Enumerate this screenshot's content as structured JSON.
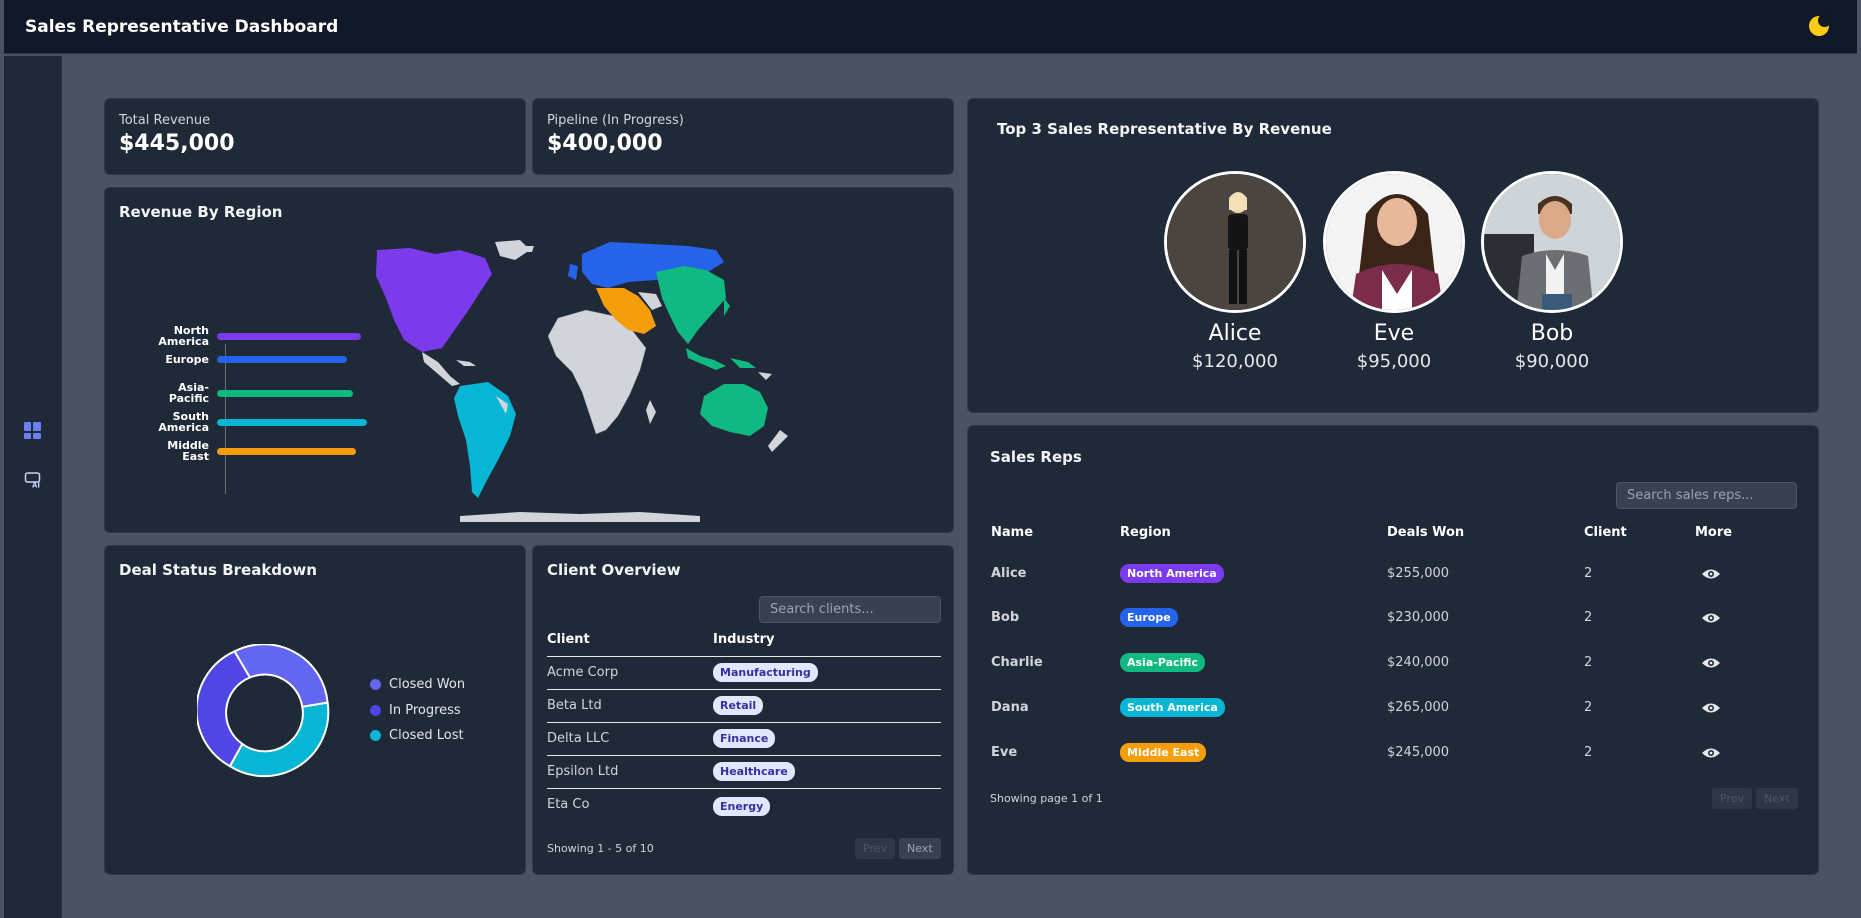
{
  "header": {
    "title": "Sales Representative Dashboard",
    "theme_icon": "moon-icon"
  },
  "sidebar": {
    "items": [
      {
        "icon": "dashboard-icon"
      },
      {
        "icon": "ai-icon"
      }
    ]
  },
  "kpis": {
    "total_revenue": {
      "label": "Total Revenue",
      "value": "$445,000"
    },
    "pipeline": {
      "label": "Pipeline (In Progress)",
      "value": "$400,000"
    }
  },
  "revenue_by_region": {
    "title": "Revenue By Region",
    "regions": [
      {
        "label_line1": "North",
        "label_line2": "America",
        "color": "#7c3aed"
      },
      {
        "label_line1": "Europe",
        "label_line2": "",
        "color": "#2563eb"
      },
      {
        "label_line1": "Asia-Pacific",
        "label_line2": "",
        "color": "#10b981"
      },
      {
        "label_line1": "South",
        "label_line2": "America",
        "color": "#06b6d4"
      },
      {
        "label_line1": "Middle East",
        "label_line2": "",
        "color": "#f59e0b"
      }
    ]
  },
  "chart_data": {
    "type": "bar",
    "categories": [
      "North America",
      "Europe",
      "Asia-Pacific",
      "South America",
      "Middle East"
    ],
    "values": [
      255000,
      230000,
      240000,
      265000,
      245000
    ],
    "title": "Revenue By Region"
  },
  "deal_status": {
    "title": "Deal Status Breakdown",
    "legend": [
      {
        "label": "Closed Won",
        "color": "#6366f1"
      },
      {
        "label": "In Progress",
        "color": "#4f46e5"
      },
      {
        "label": "Closed Lost",
        "color": "#06b6d4"
      }
    ]
  },
  "client_overview": {
    "title": "Client Overview",
    "search_placeholder": "Search clients...",
    "headers": {
      "client": "Client",
      "industry": "Industry"
    },
    "rows": [
      {
        "client": "Acme Corp",
        "industry": "Manufacturing"
      },
      {
        "client": "Beta Ltd",
        "industry": "Retail"
      },
      {
        "client": "Delta LLC",
        "industry": "Finance"
      },
      {
        "client": "Epsilon Ltd",
        "industry": "Healthcare"
      },
      {
        "client": "Eta Co",
        "industry": "Energy"
      }
    ],
    "footer": "Showing 1 - 5 of 10",
    "prev": "Prev",
    "next": "Next"
  },
  "top_reps": {
    "title": "Top 3 Sales Representative By Revenue",
    "reps": [
      {
        "name": "Alice",
        "revenue": "$120,000"
      },
      {
        "name": "Eve",
        "revenue": "$95,000"
      },
      {
        "name": "Bob",
        "revenue": "$90,000"
      }
    ]
  },
  "sales_reps": {
    "title": "Sales Reps",
    "search_placeholder": "Search sales reps...",
    "headers": {
      "name": "Name",
      "region": "Region",
      "deals": "Deals Won",
      "client": "Client",
      "more": "More"
    },
    "rows": [
      {
        "name": "Alice",
        "region": "North America",
        "region_color": "#7c3aed",
        "deals": "$255,000",
        "client": "2"
      },
      {
        "name": "Bob",
        "region": "Europe",
        "region_color": "#2563eb",
        "deals": "$230,000",
        "client": "2"
      },
      {
        "name": "Charlie",
        "region": "Asia-Pacific",
        "region_color": "#10b981",
        "deals": "$240,000",
        "client": "2"
      },
      {
        "name": "Dana",
        "region": "South America",
        "region_color": "#06b6d4",
        "deals": "$265,000",
        "client": "2"
      },
      {
        "name": "Eve",
        "region": "Middle East",
        "region_color": "#f59e0b",
        "deals": "$245,000",
        "client": "2"
      }
    ],
    "footer": "Showing page 1 of 1",
    "prev": "Prev",
    "next": "Next"
  }
}
